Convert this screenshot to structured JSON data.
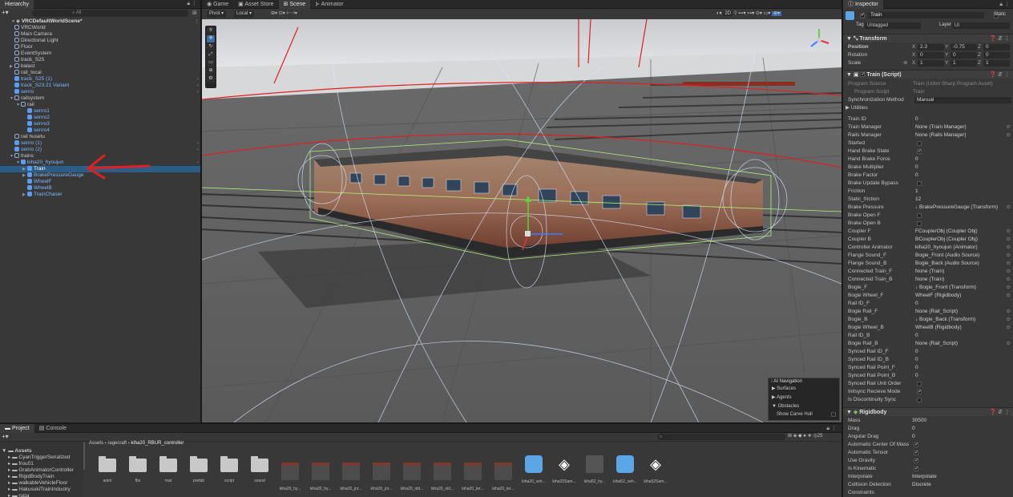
{
  "hierarchy": {
    "tab": "Hierarchy",
    "search_placeholder": "All",
    "scene": "VRCDefaultWorldScene*",
    "items": [
      {
        "label": "VRCWorld",
        "indent": 2,
        "prefab": false,
        "arrow": ""
      },
      {
        "label": "Main Camera",
        "indent": 2,
        "prefab": false,
        "arrow": ""
      },
      {
        "label": "Directional Light",
        "indent": 2,
        "prefab": false,
        "arrow": ""
      },
      {
        "label": "Floor",
        "indent": 2,
        "prefab": false,
        "arrow": ""
      },
      {
        "label": "EventSystem",
        "indent": 2,
        "prefab": false,
        "arrow": ""
      },
      {
        "label": "track_S25",
        "indent": 2,
        "prefab": false,
        "arrow": ""
      },
      {
        "label": "balast",
        "indent": 2,
        "prefab": false,
        "arrow": "▶"
      },
      {
        "label": "rail_local",
        "indent": 2,
        "prefab": false,
        "arrow": ""
      },
      {
        "label": "track_S25 (1)",
        "indent": 2,
        "prefab": true,
        "arrow": ""
      },
      {
        "label": "track_S23.21 Variant",
        "indent": 2,
        "prefab": true,
        "arrow": ""
      },
      {
        "label": "senro",
        "indent": 2,
        "prefab": true,
        "arrow": ""
      },
      {
        "label": "railsystem",
        "indent": 2,
        "prefab": false,
        "arrow": "▼"
      },
      {
        "label": "rail",
        "indent": 3,
        "prefab": false,
        "arrow": "▼"
      },
      {
        "label": "senro1",
        "indent": 4,
        "prefab": true,
        "arrow": ""
      },
      {
        "label": "senro2",
        "indent": 4,
        "prefab": true,
        "arrow": ""
      },
      {
        "label": "senro3",
        "indent": 4,
        "prefab": true,
        "arrow": ""
      },
      {
        "label": "senro4",
        "indent": 4,
        "prefab": true,
        "arrow": ""
      },
      {
        "label": "rail husetu",
        "indent": 2,
        "prefab": false,
        "arrow": ""
      },
      {
        "label": "senro (1)",
        "indent": 2,
        "prefab": true,
        "arrow": ""
      },
      {
        "label": "senro (2)",
        "indent": 2,
        "prefab": true,
        "arrow": ""
      },
      {
        "label": "trains",
        "indent": 2,
        "prefab": false,
        "arrow": "▼"
      },
      {
        "label": "kiha20_hyoujun",
        "indent": 3,
        "prefab": true,
        "arrow": "▼"
      },
      {
        "label": "Train",
        "indent": 4,
        "prefab": true,
        "arrow": "▶",
        "selected": true
      },
      {
        "label": "BrakePressureGauge",
        "indent": 4,
        "prefab": true,
        "arrow": "▶"
      },
      {
        "label": "WheelF",
        "indent": 4,
        "prefab": true,
        "arrow": ""
      },
      {
        "label": "WheelB",
        "indent": 4,
        "prefab": true,
        "arrow": ""
      },
      {
        "label": "TrainChaser",
        "indent": 4,
        "prefab": true,
        "arrow": "▶"
      }
    ]
  },
  "scene_tabs": [
    "Game",
    "Asset Store",
    "Scene",
    "Animator"
  ],
  "scene_toolbar": {
    "pivot": "Pivot",
    "local": "Local",
    "mode2d": "2D",
    "persp": "◁ Persp"
  },
  "ai_nav": {
    "title": "AI Navigation",
    "items": [
      "Surfaces",
      "Agents",
      "Obstacles"
    ],
    "show_carve": "Show Carve Hull"
  },
  "inspector": {
    "tab": "Inspector",
    "object_name": "Train",
    "static_label": "Static",
    "tag_label": "Tag",
    "tag_value": "Untagged",
    "layer_label": "Layer",
    "layer_value": "UI",
    "transform": {
      "title": "Transform",
      "position": {
        "label": "Position",
        "x": "2.3",
        "y": "-0.75",
        "z": "0"
      },
      "rotation": {
        "label": "Rotation",
        "x": "0",
        "y": "0",
        "z": "0"
      },
      "scale": {
        "label": "Scale",
        "x": "1",
        "y": "1",
        "z": "1"
      }
    },
    "script": {
      "title": "Train (Script)",
      "program_source_label": "Program Source",
      "program_source": "Train (Udon Sharp Program Asset)",
      "program_script_label": "Program Script",
      "program_script": "Train",
      "sync_label": "Synchronization Method",
      "sync_value": "Manual",
      "utilities": "Utilities",
      "fields": [
        {
          "label": "Train ID",
          "value": "0"
        },
        {
          "label": "Train Manager",
          "value": "None (Train Manager)"
        },
        {
          "label": "Rails Manager",
          "value": "None (Rails Manager)"
        },
        {
          "label": "Started",
          "check": false
        },
        {
          "label": "Hand Brake State",
          "check": true
        },
        {
          "label": "Hand Brake Force",
          "value": "0"
        },
        {
          "label": "Brake Multiplier",
          "value": "0"
        },
        {
          "label": "Brake Factor",
          "value": "0"
        },
        {
          "label": "Brake Update Bypass",
          "check": false
        },
        {
          "label": "Friction",
          "value": "1"
        },
        {
          "label": "Static_friction",
          "value": "12"
        },
        {
          "label": "Brake Pressure",
          "value": "↓ BrakePressureGauge (Transform)"
        },
        {
          "label": "Brake Open F",
          "check": false
        },
        {
          "label": "Brake Open B",
          "check": false
        },
        {
          "label": "Coupler F",
          "value": "FCouplerObj (Coupler Obj)"
        },
        {
          "label": "Coupler B",
          "value": "BCouplerObj (Coupler Obj)"
        },
        {
          "label": "Controller Animator",
          "value": "kiha20_hyoujun (Animator)"
        },
        {
          "label": "Flange Sound_F",
          "value": "Bogie_Front (Audio Source)"
        },
        {
          "label": "Flange Sound_B",
          "value": "Bogie_Back (Audio Source)"
        },
        {
          "label": "Connected Train_F",
          "value": "None (Train)"
        },
        {
          "label": "Connected Train_B",
          "value": "None (Train)"
        },
        {
          "label": "Bogie_F",
          "value": "↓ Bogie_Front (Transform)"
        },
        {
          "label": "Bogie Wheel_F",
          "value": "WheelF (Rigidbody)"
        },
        {
          "label": "Rail ID_F",
          "value": "0"
        },
        {
          "label": "Bogie Rail_F",
          "value": "None (Rail_Script)"
        },
        {
          "label": "Bogie_B",
          "value": "↓ Bogie_Back (Transform)"
        },
        {
          "label": "Bogie Wheel_B",
          "value": "WheelB (Rigidbody)"
        },
        {
          "label": "Rail ID_B",
          "value": "0"
        },
        {
          "label": "Bogie Rail_B",
          "value": "None (Rail_Script)"
        },
        {
          "label": "Synced Rail ID_F",
          "value": "0"
        },
        {
          "label": "Synced Rail ID_B",
          "value": "0"
        },
        {
          "label": "Synced Rail Point_F",
          "value": "0"
        },
        {
          "label": "Synced Rail Point_B",
          "value": "0"
        },
        {
          "label": "Synced Rail Unit Order",
          "check": false
        },
        {
          "label": "Initsync Recieve Mode",
          "check": true
        },
        {
          "label": "Is Discontinuity Sync",
          "check": false
        }
      ]
    },
    "rigidbody": {
      "title": "Rigidbody",
      "fields": [
        {
          "label": "Mass",
          "value": "30500"
        },
        {
          "label": "Drag",
          "value": "0"
        },
        {
          "label": "Angular Drag",
          "value": "0"
        },
        {
          "label": "Automatic Center Of Mass",
          "check": true
        },
        {
          "label": "Automatic Tensor",
          "check": true
        },
        {
          "label": "Use Gravity",
          "check": true
        },
        {
          "label": "Is Kinematic",
          "check": true
        },
        {
          "label": "Interpolate",
          "value": "Interpolate"
        },
        {
          "label": "Collision Detection",
          "value": "Discrete"
        },
        {
          "label": "Constraints",
          "value": ""
        }
      ]
    }
  },
  "project": {
    "tabs": [
      "Project",
      "Console"
    ],
    "count": "25",
    "breadcrumb": [
      "Assets",
      "ragecraft",
      "kiha20_RBUR_controller"
    ],
    "tree": [
      "Assets",
      "CyanTriggerSerialized",
      "frou01",
      "GrabAnimatorController",
      "RigidBodyTrain",
      "walkableVehicleFloor",
      "HakusukiTrainIndustry",
      "rupa"
    ],
    "assets": [
      {
        "name": "anim",
        "kind": "folder"
      },
      {
        "name": "fbx",
        "kind": "folder"
      },
      {
        "name": "mat",
        "kind": "folder"
      },
      {
        "name": "prefab",
        "kind": "folder"
      },
      {
        "name": "script",
        "kind": "folder"
      },
      {
        "name": "sound",
        "kind": "folder"
      },
      {
        "name": "kiha20_hy...",
        "kind": "train"
      },
      {
        "name": "kiha20_hy...",
        "kind": "train"
      },
      {
        "name": "kiha20_jnr...",
        "kind": "train"
      },
      {
        "name": "kiha20_jnr...",
        "kind": "train"
      },
      {
        "name": "kiha20_old...",
        "kind": "train"
      },
      {
        "name": "kiha20_old...",
        "kind": "train"
      },
      {
        "name": "kiha20_ter...",
        "kind": "train"
      },
      {
        "name": "kiha20_ter...",
        "kind": "train"
      },
      {
        "name": "kiha20_veh...",
        "kind": "cube"
      },
      {
        "name": "kiha20Sam...",
        "kind": "unity"
      },
      {
        "name": "kiha52_hy...",
        "kind": "gray"
      },
      {
        "name": "kiha52_veh...",
        "kind": "cube"
      },
      {
        "name": "kiha52Sam...",
        "kind": "unity"
      }
    ]
  }
}
